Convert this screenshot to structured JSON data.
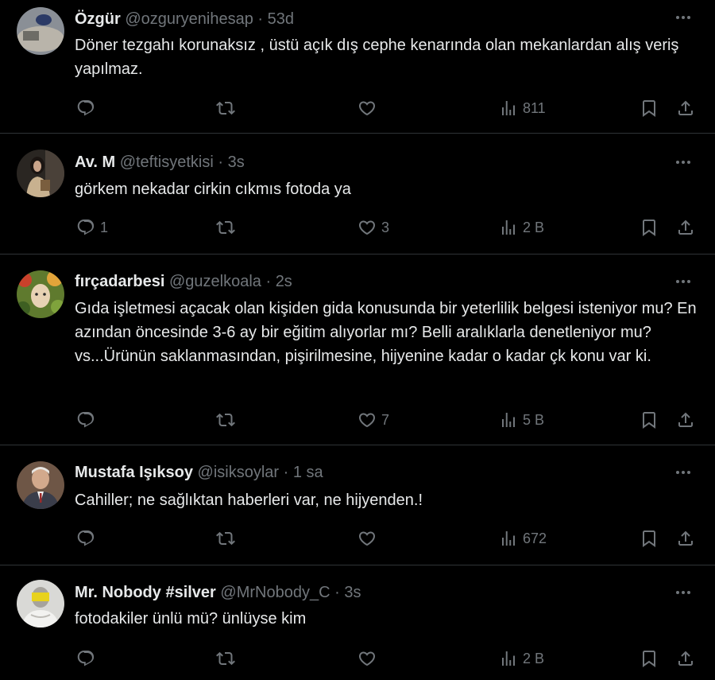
{
  "tweets": [
    {
      "name": "Özgür",
      "handle": "@ozguryenihesap",
      "dot": "·",
      "time": "53d",
      "text": "Döner tezgahı korunaksız , üstü açık dış cephe kenarında olan mekanlardan alış veriş yapılmaz.",
      "replies": "",
      "retweets": "",
      "likes": "",
      "views": "811"
    },
    {
      "name": "Av. M",
      "handle": "@teftisyetkisi",
      "dot": "·",
      "time": "3s",
      "text": "görkem nekadar cirkin cıkmıs fotoda ya",
      "replies": "1",
      "retweets": "",
      "likes": "3",
      "views": "2 B"
    },
    {
      "name": "fırçadarbesi",
      "handle": "@guzelkoala",
      "dot": "·",
      "time": "2s",
      "text": "Gıda işletmesi açacak olan kişiden gida konusunda bir yeterlilik belgesi isteniyor mu? En azından öncesinde 3-6 ay bir eğitim alıyorlar mı? Belli aralıklarla denetleniyor mu?vs...Ürünün saklanmasından, pişirilmesine, hijyenine kadar o kadar çk konu var ki.",
      "replies": "",
      "retweets": "",
      "likes": "7",
      "views": "5 B"
    },
    {
      "name": "Mustafa Işıksoy",
      "handle": "@isiksoylar",
      "dot": "·",
      "time": "1 sa",
      "text": "Cahiller; ne sağlıktan haberleri var, ne hijyenden.!",
      "replies": "",
      "retweets": "",
      "likes": "",
      "views": "672"
    },
    {
      "name": "Mr. Nobody #silver",
      "handle": "@MrNobody_C",
      "dot": "·",
      "time": "3s",
      "text": "fotodakiler ünlü mü? ünlüyse kim",
      "replies": "",
      "retweets": "",
      "likes": "",
      "views": "2 B"
    }
  ],
  "icons": {
    "reply": "reply-icon",
    "retweet": "retweet-icon",
    "like": "heart-icon",
    "views": "views-icon",
    "bookmark": "bookmark-icon",
    "share": "share-icon",
    "more": "more-icon"
  },
  "colors": {
    "background": "#000000",
    "text": "#e7e9ea",
    "secondary": "#71767b",
    "divider": "#2f3336"
  }
}
